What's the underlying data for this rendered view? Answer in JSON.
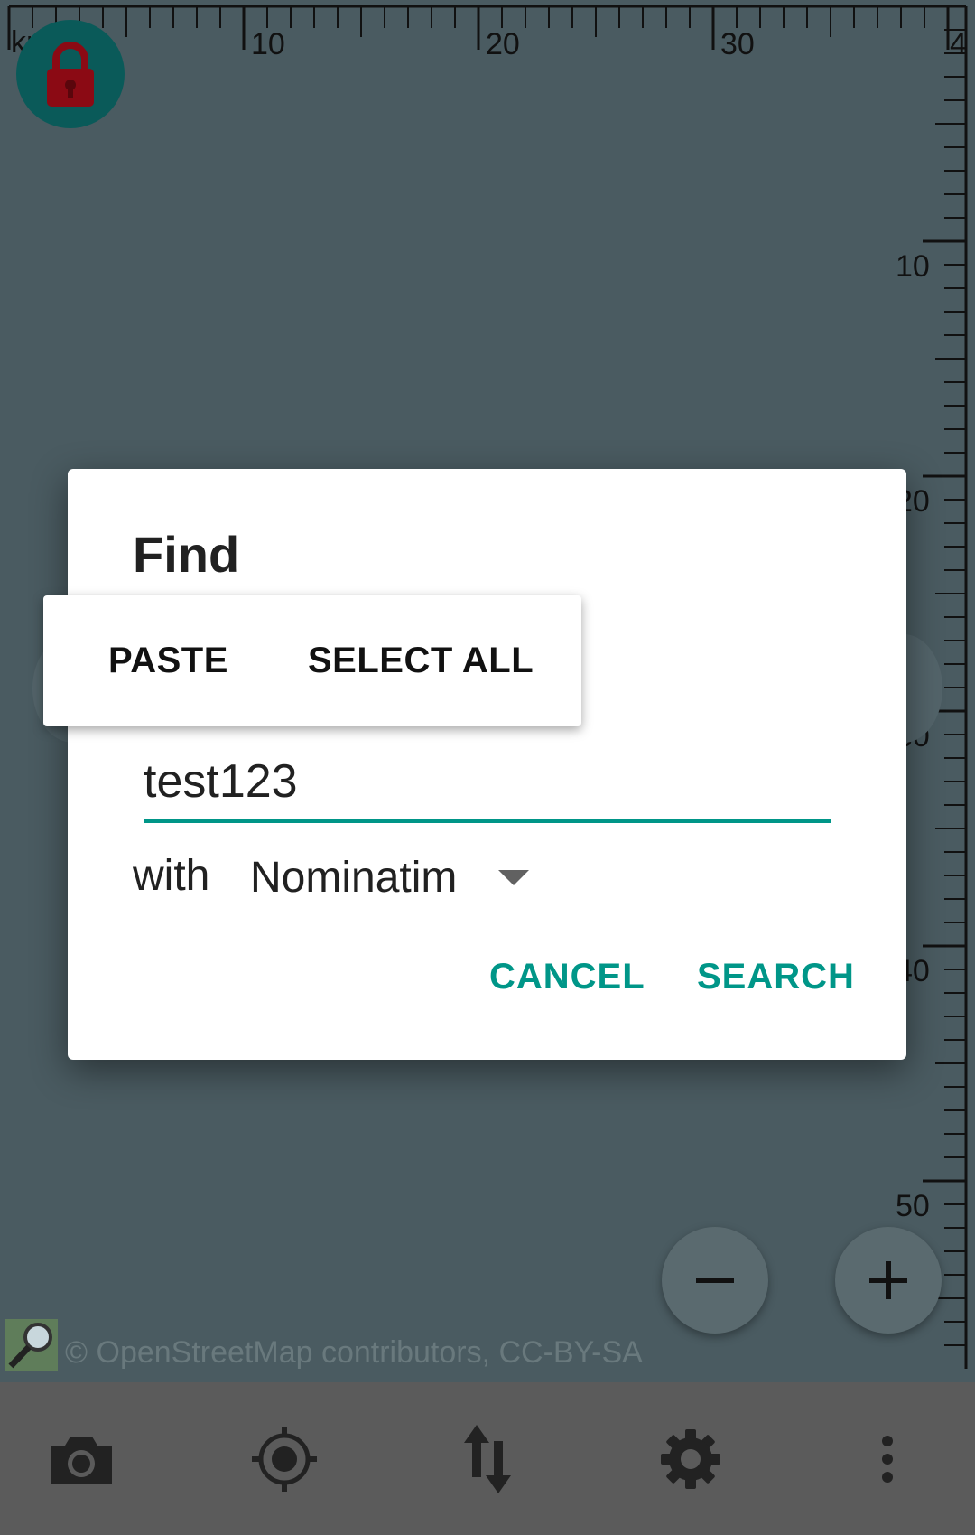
{
  "map": {
    "ruler": {
      "unit_label": "km",
      "top_ticks": [
        "10",
        "20",
        "30",
        "4"
      ],
      "right_ticks": [
        "10",
        "20",
        "30",
        "40",
        "50"
      ]
    },
    "attribution": "© OpenStreetMap contributors, CC-BY-SA",
    "lock_icon": "lock-icon",
    "zoom_out_icon": "minus-icon",
    "zoom_in_icon": "plus-icon"
  },
  "dialog": {
    "title": "Find",
    "input_value": "test123",
    "with_label": "with",
    "provider": "Nominatim",
    "cancel_label": "CANCEL",
    "search_label": "SEARCH"
  },
  "context_menu": {
    "paste_label": "PASTE",
    "select_all_label": "SELECT ALL"
  },
  "bottom_bar": {
    "icons": [
      "camera-icon",
      "gps-locate-icon",
      "transfer-icon",
      "settings-icon",
      "more-icon"
    ]
  },
  "colors": {
    "accent": "#009688",
    "map_background": "#4a5b61",
    "lock_red": "#8b0a14",
    "bottom_bar": "#5b5b5b"
  }
}
